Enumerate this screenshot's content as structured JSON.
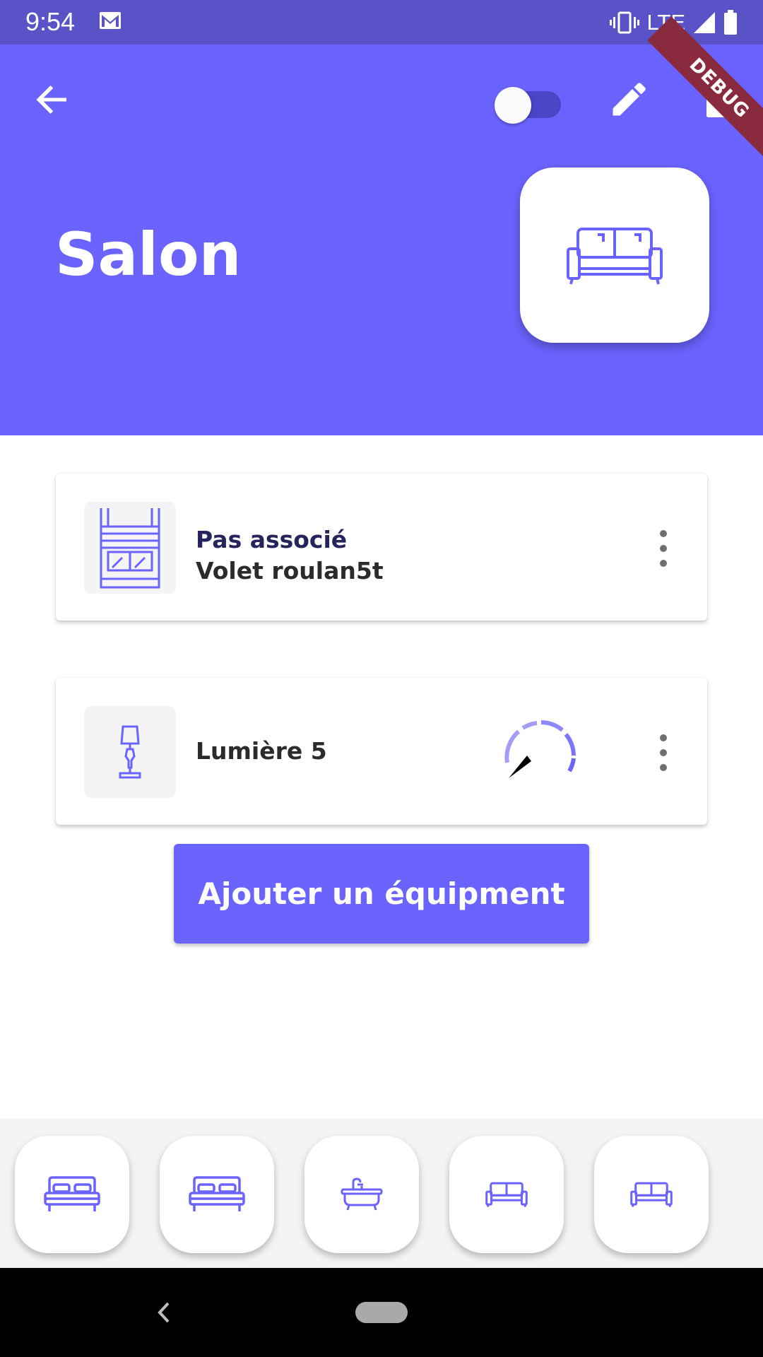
{
  "status_bar": {
    "time": "9:54",
    "network": "LTE",
    "debug_banner": "DEBUG",
    "icons": [
      "gmail-icon",
      "vibrate-icon",
      "signal-icon",
      "battery-icon"
    ]
  },
  "header": {
    "room_title": "Salon",
    "room_icon": "sofa-icon",
    "toggle_on": false,
    "actions": [
      "back-arrow-icon",
      "edit-pencil-icon",
      "trash-icon"
    ],
    "background_color": "#6b63fe"
  },
  "devices": [
    {
      "icon": "window-shutter-icon",
      "status": "Pas associé",
      "name": "Volet roulan5t"
    },
    {
      "icon": "lamp-icon",
      "name": "Lumière 5",
      "dimmer_icon": "dimmer-dial-icon"
    }
  ],
  "add_button": {
    "label": "Ajouter un équipment"
  },
  "room_bar": {
    "rooms": [
      {
        "icon": "bed-icon"
      },
      {
        "icon": "bed-icon"
      },
      {
        "icon": "bathtub-icon"
      },
      {
        "icon": "sofa-icon"
      },
      {
        "icon": "sofa-icon"
      }
    ]
  },
  "colors": {
    "accent": "#6b63fe",
    "status_bar": "#5a53c8",
    "dark_text": "#27235d"
  }
}
